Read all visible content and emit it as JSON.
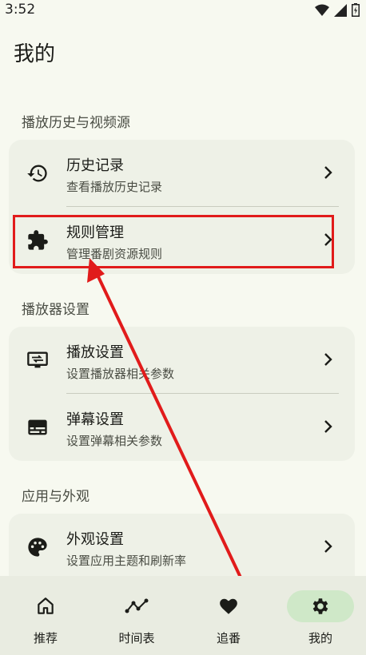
{
  "status": {
    "time": "3:52"
  },
  "page": {
    "title": "我的"
  },
  "sections": [
    {
      "header": "播放历史与视频源"
    },
    {
      "header": "播放器设置"
    },
    {
      "header": "应用与外观"
    }
  ],
  "items": {
    "history": {
      "title": "历史记录",
      "subtitle": "查看播放历史记录",
      "icon": "history-icon"
    },
    "rules": {
      "title": "规则管理",
      "subtitle": "管理番剧资源规则",
      "icon": "extension-puzzle-icon"
    },
    "player": {
      "title": "播放设置",
      "subtitle": "设置播放器相关参数",
      "icon": "tv-settings-icon"
    },
    "danmaku": {
      "title": "弹幕设置",
      "subtitle": "设置弹幕相关参数",
      "icon": "subtitles-icon"
    },
    "appearance": {
      "title": "外观设置",
      "subtitle": "设置应用主题和刷新率",
      "icon": "palette-icon"
    }
  },
  "nav": [
    {
      "label": "推荐",
      "icon": "home-icon"
    },
    {
      "label": "时间表",
      "icon": "timeline-icon"
    },
    {
      "label": "追番",
      "icon": "heart-icon"
    },
    {
      "label": "我的",
      "icon": "gear-icon",
      "active": true
    }
  ],
  "colors": {
    "accent": "#cfe8c8",
    "highlight": "#e11b1b",
    "background": "#f7f9f0",
    "card": "#eef1e7"
  }
}
